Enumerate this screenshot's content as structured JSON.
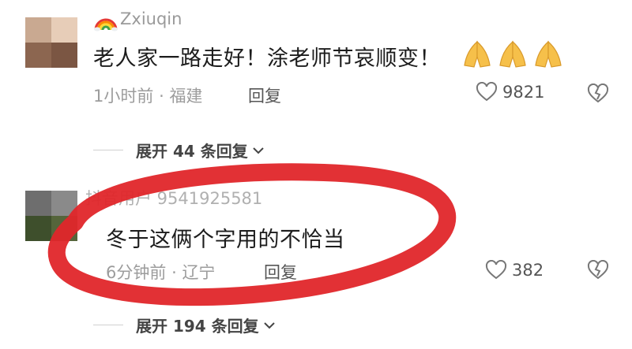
{
  "comments": [
    {
      "username": "Zxiuqin",
      "username_prefix_icon": "rainbow-icon",
      "avatar_colors": [
        "#c9a991",
        "#e7cdb8",
        "#8c6650",
        "#7b5643"
      ],
      "text": "老人家一路走好！涂老师节哀顺变！",
      "text_emoji": "folded-hands-icon",
      "time": "1小时前",
      "separator": "·",
      "location": "福建",
      "reply_label": "回复",
      "likes": "9821",
      "expand_label": "展开 44 条回复"
    },
    {
      "username": "抖音用户 9541925581",
      "avatar_colors": [
        "#6e6e6e",
        "#8a8a8a",
        "#3e4f2c",
        "#55653b"
      ],
      "text": "冬于这俩个字用的不恰当",
      "time": "6分钟前",
      "separator": "·",
      "location": "辽宁",
      "reply_label": "回复",
      "likes": "382",
      "expand_label": "展开 194 条回复"
    }
  ],
  "annotation_color": "#e0262a"
}
